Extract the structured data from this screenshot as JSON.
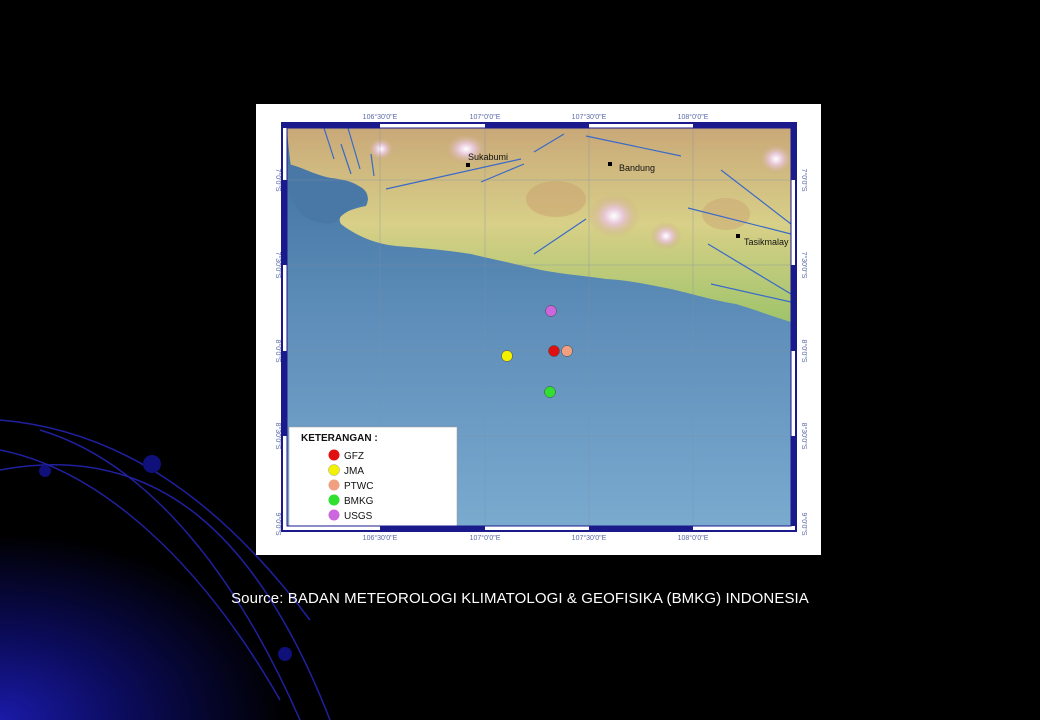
{
  "map": {
    "cities": [
      {
        "name": "Sukabumi"
      },
      {
        "name": "Bandung"
      },
      {
        "name": "Tasikmalay"
      }
    ],
    "top_ticks": [
      "106°30'0\"E",
      "107°0'0\"E",
      "107°30'0\"E",
      "108°0'0\"E"
    ],
    "bottom_ticks": [
      "106°30'0\"E",
      "107°0'0\"E",
      "107°30'0\"E",
      "108°0'0\"E"
    ],
    "left_ticks": [
      "7°0'0\"S",
      "7°30'0\"S",
      "8°0'0\"S",
      "8°30'0\"S",
      "9°0'0\"S"
    ],
    "right_ticks": [
      "7°0'0\"S",
      "7°30'0\"S",
      "8°0'0\"S",
      "8°30'0\"S",
      "9°0'0\"S"
    ],
    "legend": {
      "title": "KETERANGAN :",
      "items": [
        {
          "label": "GFZ",
          "color": "#e01010"
        },
        {
          "label": "JMA",
          "color": "#f2f200"
        },
        {
          "label": "PTWC",
          "color": "#f0a080"
        },
        {
          "label": "BMKG",
          "color": "#30e030"
        },
        {
          "label": "USGS",
          "color": "#cc66dd"
        }
      ]
    },
    "epicenters": [
      {
        "agency": "GFZ",
        "color": "#e01010"
      },
      {
        "agency": "JMA",
        "color": "#f2f200"
      },
      {
        "agency": "PTWC",
        "color": "#f0a080"
      },
      {
        "agency": "BMKG",
        "color": "#30e030"
      },
      {
        "agency": "USGS",
        "color": "#cc66dd"
      }
    ],
    "colors": {
      "frame": "#1a1a8c",
      "sea_light": "#6f9fc4",
      "sea_dark": "#3f6f9e",
      "land_low": "#a8c870",
      "land_high": "#e8d090"
    }
  },
  "caption": {
    "text": "Source: BADAN METEOROLOGI KLIMATOLOGI & GEOFISIKA (BMKG) INDONESIA"
  }
}
